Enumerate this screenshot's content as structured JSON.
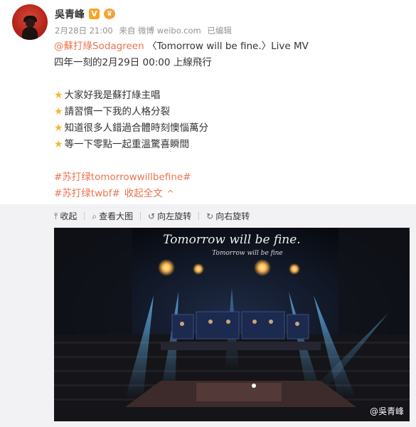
{
  "post": {
    "username": "吳青峰",
    "verified_badge": "V",
    "member_badge": "♛",
    "time": "2月28日 21:00",
    "source": "来自 微博 weibo.com",
    "edited": "已编辑"
  },
  "content": {
    "mention": "@蘇打綠Sodagreen",
    "line1_rest": " 〈Tomorrow will be fine.〉Live MV",
    "line2": "四年一刻的2月29日 00:00 上線飛行",
    "star_icon": "★",
    "star_lines": [
      "大家好我是蘇打綠主唱",
      "請習慣一下我的人格分裂",
      "知道很多人錯過合體時刻懊惱萬分",
      "等一下零點一起重溫驚喜瞬間"
    ],
    "hashtag1": "#苏打绿tomorrowwillbefine#",
    "hashtag2": "#苏打绿twbf#",
    "collapse_label": "收起全文",
    "caret": "^"
  },
  "toolbar": {
    "collapse": "收起",
    "view_large": "查看大图",
    "rotate_left": "向左旋转",
    "rotate_right": "向右旋转"
  },
  "photo": {
    "stage_title": "Tomorrow will be fine.",
    "stage_subtitle": "Tomorrow will be fine",
    "watermark": "@吳青峰",
    "colors": {
      "bg": "#0b0d12",
      "beam": "#4aa8e8",
      "lamp": "#ffb347",
      "screen": "#3b5fb0"
    }
  }
}
